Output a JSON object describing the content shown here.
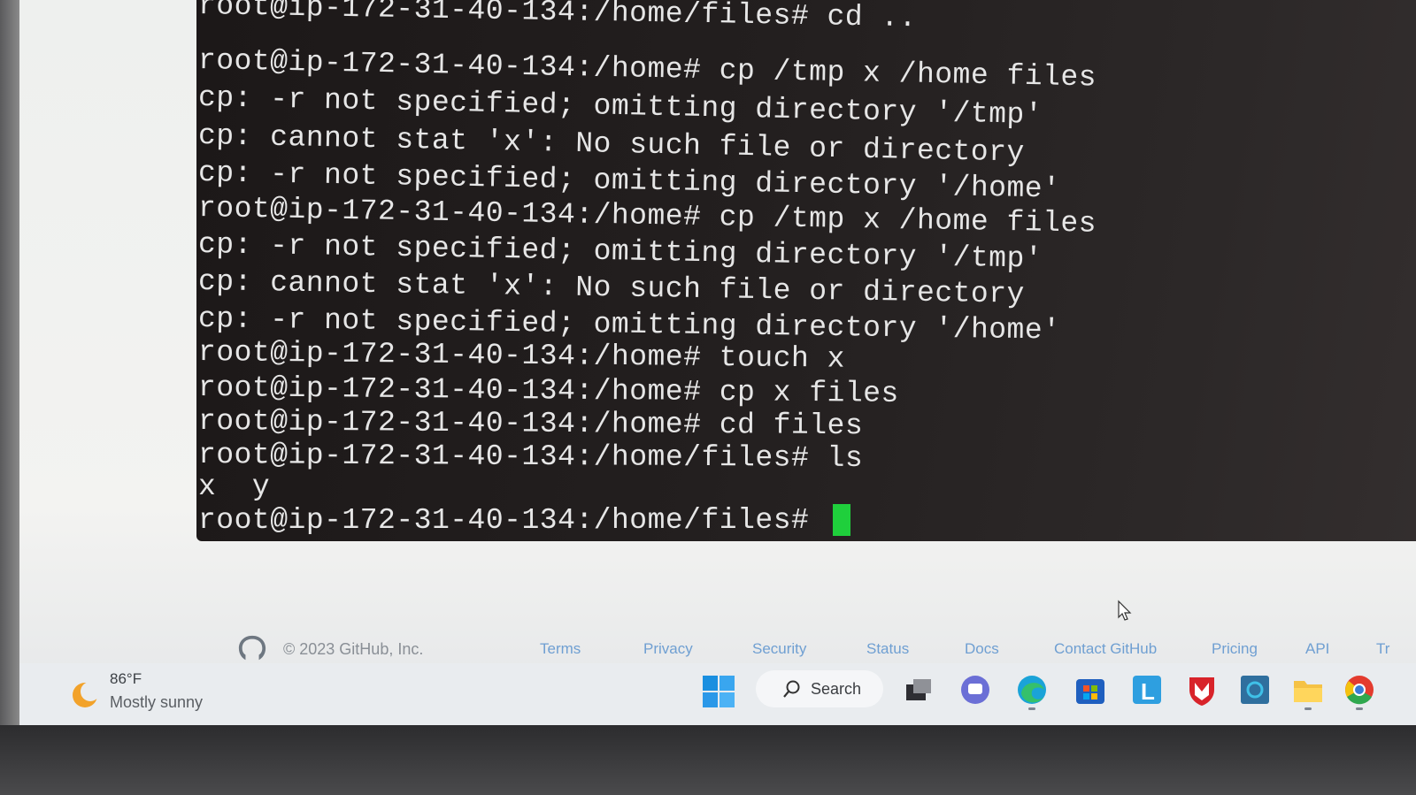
{
  "terminal": {
    "lines": [
      "root@ip-172-31-40-134:/home/files# cd ..",
      "root@ip-172-31-40-134:/home# cp /tmp x /home files",
      "cp: -r not specified; omitting directory '/tmp'",
      "cp: cannot stat 'x': No such file or directory",
      "cp: -r not specified; omitting directory '/home'",
      "root@ip-172-31-40-134:/home# cp /tmp x /home files",
      "cp: -r not specified; omitting directory '/tmp'",
      "cp: cannot stat 'x': No such file or directory",
      "cp: -r not specified; omitting directory '/home'",
      "root@ip-172-31-40-134:/home# touch x",
      "root@ip-172-31-40-134:/home# cp x files",
      "root@ip-172-31-40-134:/home# cd files",
      "root@ip-172-31-40-134:/home/files# ls",
      "x  y"
    ],
    "prompt": "root@ip-172-31-40-134:/home/files# ",
    "cursor_color": "#1fcf3c"
  },
  "footer": {
    "copyright": "© 2023 GitHub, Inc.",
    "links": [
      "Terms",
      "Privacy",
      "Security",
      "Status",
      "Docs",
      "Contact GitHub",
      "Pricing",
      "API",
      "Tr"
    ]
  },
  "taskbar": {
    "weather": {
      "temp": "86°F",
      "condition": "Mostly sunny",
      "icon": "sun-icon"
    },
    "search_label": "Search",
    "apps": [
      "task-view",
      "teams-chat",
      "edge",
      "microsoft-store",
      "l-app",
      "mcafee",
      "outlook-o-app",
      "file-explorer",
      "chrome"
    ]
  }
}
